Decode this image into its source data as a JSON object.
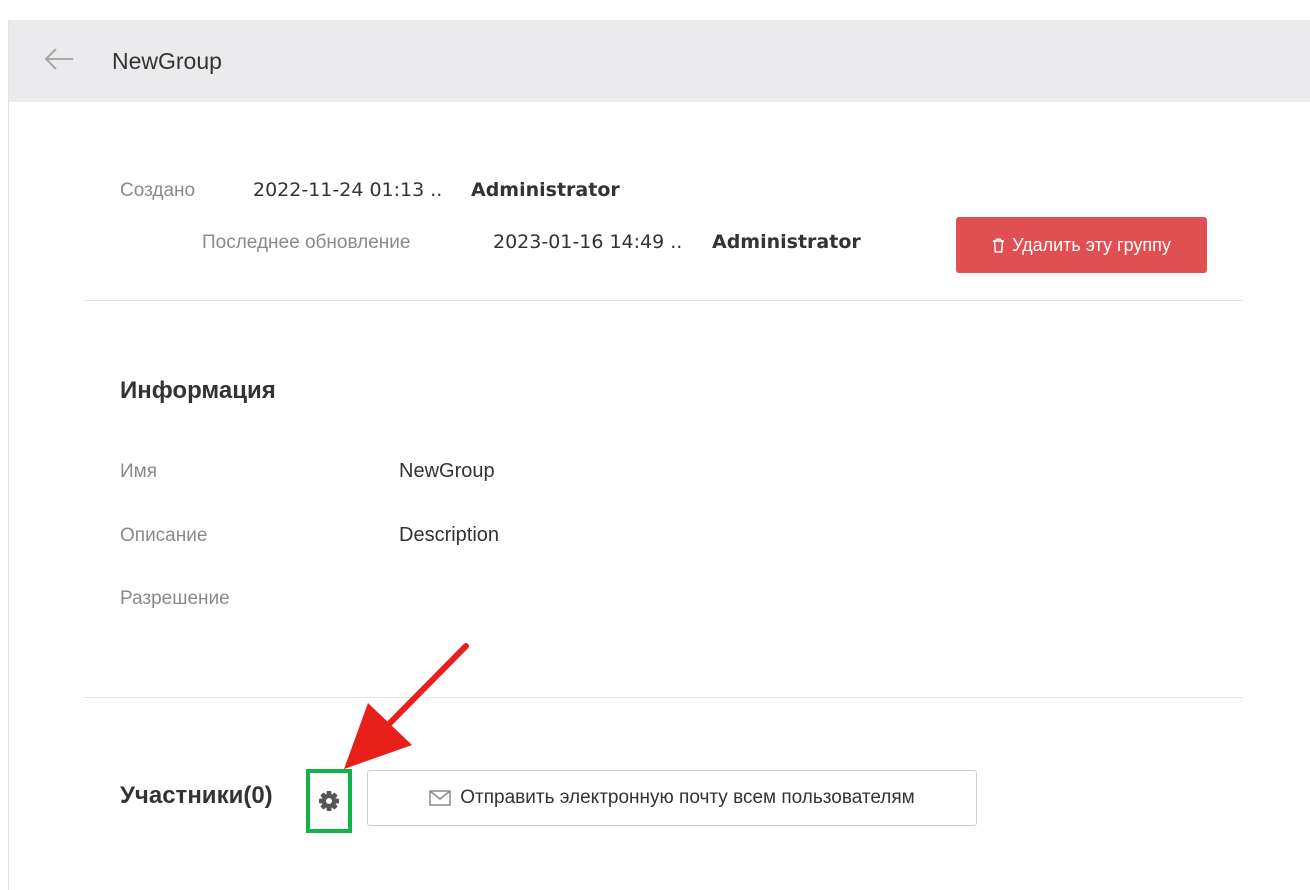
{
  "header": {
    "title": "NewGroup",
    "back_icon": "arrow-left-icon"
  },
  "meta": {
    "created_label": "Создано",
    "created_date": "2022-11-24 01:13 ..",
    "created_by": "Administrator",
    "updated_label": "Последнее обновление",
    "updated_date": "2023-01-16 14:49 ..",
    "updated_by": "Administrator"
  },
  "actions": {
    "delete_label": "Удалить эту группу",
    "delete_icon": "trash-icon",
    "delete_color": "#e04f51"
  },
  "info": {
    "title": "Информация",
    "fields": [
      {
        "label": "Имя",
        "value": "NewGroup"
      },
      {
        "label": "Описание",
        "value": "Description"
      },
      {
        "label": "Разрешение",
        "value": ""
      }
    ]
  },
  "members": {
    "title": "Участники(0)",
    "settings_icon": "gear-icon",
    "highlight_color": "#12b34a",
    "email_icon": "envelope-icon",
    "email_label": "Отправить электронную почту всем пользователям"
  },
  "annotation": {
    "arrow_color": "#e8201c"
  }
}
